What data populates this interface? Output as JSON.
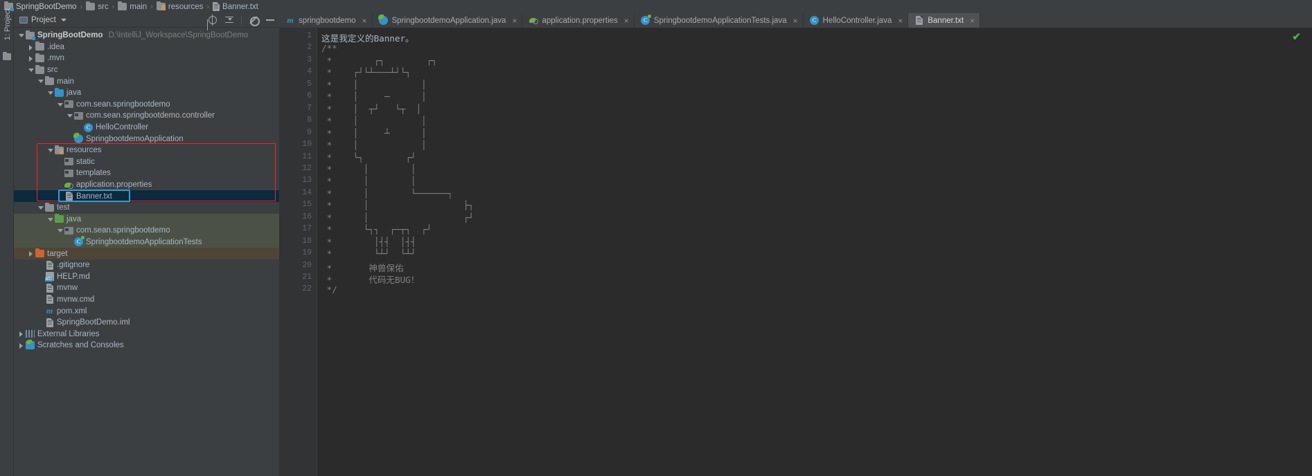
{
  "breadcrumb": {
    "items": [
      {
        "label": "SpringBootDemo",
        "icon": "module-folder-icon"
      },
      {
        "label": "src",
        "icon": "folder-icon"
      },
      {
        "label": "main",
        "icon": "folder-icon"
      },
      {
        "label": "resources",
        "icon": "resources-folder-icon"
      },
      {
        "label": "Banner.txt",
        "icon": "file-icon"
      }
    ],
    "separator": "›"
  },
  "left_strip": {
    "project_tab_label": "1: Project"
  },
  "project_toolbar": {
    "title": "Project",
    "caret": "▾",
    "buttons": [
      {
        "name": "locate-file-button",
        "icon": "target-icon"
      },
      {
        "name": "collapse-all-button",
        "icon": "collapse-all-icon"
      },
      {
        "name": "settings-button",
        "icon": "gear-icon"
      },
      {
        "name": "hide-button",
        "icon": "minus-icon"
      }
    ]
  },
  "tree": {
    "rows": [
      {
        "label": "SpringBootDemo",
        "path": "D:\\IntelliJ_Workspace\\SpringBootDemo",
        "indent": 0,
        "arrow": "open",
        "icon": "module-folder-icon",
        "bold": true
      },
      {
        "label": ".idea",
        "indent": 1,
        "arrow": "closed",
        "icon": "folder-icon"
      },
      {
        "label": ".mvn",
        "indent": 1,
        "arrow": "closed",
        "icon": "folder-icon"
      },
      {
        "label": "src",
        "indent": 1,
        "arrow": "open",
        "icon": "folder-icon"
      },
      {
        "label": "main",
        "indent": 2,
        "arrow": "open",
        "icon": "folder-icon"
      },
      {
        "label": "java",
        "indent": 3,
        "arrow": "open",
        "icon": "source-folder-icon"
      },
      {
        "label": "com.sean.springbootdemo",
        "indent": 4,
        "arrow": "open",
        "icon": "package-icon"
      },
      {
        "label": "com.sean.springbootdemo.controller",
        "indent": 5,
        "arrow": "open",
        "icon": "package-icon"
      },
      {
        "label": "HelloController",
        "indent": 6,
        "arrow": "none",
        "icon": "java-class-icon"
      },
      {
        "label": "SpringbootdemoApplication",
        "indent": 5,
        "arrow": "none",
        "icon": "spring-boot-class-icon"
      },
      {
        "label": "resources",
        "indent": 3,
        "arrow": "open",
        "icon": "resources-folder-icon"
      },
      {
        "label": "static",
        "indent": 4,
        "arrow": "none",
        "icon": "package-icon"
      },
      {
        "label": "templates",
        "indent": 4,
        "arrow": "none",
        "icon": "package-icon"
      },
      {
        "label": "application.properties",
        "indent": 4,
        "arrow": "none",
        "icon": "spring-properties-icon"
      },
      {
        "label": "Banner.txt",
        "indent": 4,
        "arrow": "none",
        "icon": "file-icon",
        "selected": true
      },
      {
        "label": "test",
        "indent": 2,
        "arrow": "open",
        "icon": "folder-icon"
      },
      {
        "label": "java",
        "indent": 3,
        "arrow": "open",
        "icon": "test-source-folder-icon",
        "bg": "test"
      },
      {
        "label": "com.sean.springbootdemo",
        "indent": 4,
        "arrow": "open",
        "icon": "package-icon",
        "bg": "test"
      },
      {
        "label": "SpringbootdemoApplicationTests",
        "indent": 5,
        "arrow": "none",
        "icon": "spring-test-class-icon",
        "bg": "test"
      },
      {
        "label": "target",
        "indent": 1,
        "arrow": "closed",
        "icon": "target-folder-icon",
        "bg": "target"
      },
      {
        "label": ".gitignore",
        "indent": 2,
        "arrow": "none",
        "icon": "file-icon"
      },
      {
        "label": "HELP.md",
        "indent": 2,
        "arrow": "none",
        "icon": "markdown-icon"
      },
      {
        "label": "mvnw",
        "indent": 2,
        "arrow": "none",
        "icon": "file-icon"
      },
      {
        "label": "mvnw.cmd",
        "indent": 2,
        "arrow": "none",
        "icon": "file-icon"
      },
      {
        "label": "pom.xml",
        "indent": 2,
        "arrow": "none",
        "icon": "maven-icon"
      },
      {
        "label": "SpringBootDemo.iml",
        "indent": 2,
        "arrow": "none",
        "icon": "file-icon"
      },
      {
        "label": "External Libraries",
        "indent": 0,
        "arrow": "closed",
        "icon": "library-icon"
      },
      {
        "label": "Scratches and Consoles",
        "indent": 0,
        "arrow": "closed",
        "icon": "scratch-icon"
      }
    ]
  },
  "editor_tabs": [
    {
      "label": "springbootdemo",
      "icon": "maven-icon",
      "active": false,
      "closable": true
    },
    {
      "label": "SpringbootdemoApplication.java",
      "icon": "spring-boot-class-icon",
      "active": false,
      "closable": true
    },
    {
      "label": "application.properties",
      "icon": "spring-properties-icon",
      "active": false,
      "closable": true
    },
    {
      "label": "SpringbootdemoApplicationTests.java",
      "icon": "spring-test-class-icon",
      "active": false,
      "closable": true
    },
    {
      "label": "HelloController.java",
      "icon": "java-class-icon",
      "active": false,
      "closable": true
    },
    {
      "label": "Banner.txt",
      "icon": "file-icon",
      "active": true,
      "closable": true
    }
  ],
  "editor": {
    "close_glyph": "×",
    "inspection_ok_glyph": "✔",
    "lines": [
      {
        "n": 1,
        "text": "这是我定义的Banner。",
        "style": "art"
      },
      {
        "n": 2,
        "text": "/**",
        "style": "comment"
      },
      {
        "n": 3,
        "text": " *        ┌┐        ┌┐",
        "style": "comment"
      },
      {
        "n": 4,
        "text": " *    ┌┘└┴───┴┘└┐",
        "style": "comment"
      },
      {
        "n": 5,
        "text": " *    │            │",
        "style": "comment"
      },
      {
        "n": 6,
        "text": " *    │     ─      │",
        "style": "comment"
      },
      {
        "n": 7,
        "text": " *    │  ┬┘   └┬  │",
        "style": "comment"
      },
      {
        "n": 8,
        "text": " *    │            │",
        "style": "comment"
      },
      {
        "n": 9,
        "text": " *    │     ┴      │",
        "style": "comment"
      },
      {
        "n": 10,
        "text": " *    │            │",
        "style": "comment"
      },
      {
        "n": 11,
        "text": " *    └┐        ┌┘",
        "style": "comment"
      },
      {
        "n": 12,
        "text": " *      │        │",
        "style": "comment"
      },
      {
        "n": 13,
        "text": " *      │        │",
        "style": "comment"
      },
      {
        "n": 14,
        "text": " *      │        └──────┐",
        "style": "comment"
      },
      {
        "n": 15,
        "text": " *      │                  ├┐",
        "style": "comment"
      },
      {
        "n": 16,
        "text": " *      │                  ┌┘",
        "style": "comment"
      },
      {
        "n": 17,
        "text": " *      └┐┐  ┌─┬┐  ┌┘",
        "style": "comment"
      },
      {
        "n": 18,
        "text": " *        │┤┤  │┤┤",
        "style": "comment"
      },
      {
        "n": 19,
        "text": " *        └┴┘  └┴┘",
        "style": "comment"
      },
      {
        "n": 20,
        "text": " *       神兽保佑",
        "style": "comment"
      },
      {
        "n": 21,
        "text": " *       代码无BUG！",
        "style": "comment"
      },
      {
        "n": 22,
        "text": " */",
        "style": "comment"
      }
    ]
  },
  "colors": {
    "panel_bg": "#3c3f41",
    "editor_bg": "#2b2b2b",
    "gutter_bg": "#313335",
    "text": "#a9b7c6",
    "comment": "#808080",
    "selection": "#0d293e",
    "highlight_red": "#ff2020",
    "highlight_blue": "#2f9fd8",
    "test_row": "#4b5245",
    "target_row": "#4e4536",
    "accent_blue": "#3592c4",
    "spring_green": "#6db33f",
    "ok_green": "#4fae4f"
  }
}
